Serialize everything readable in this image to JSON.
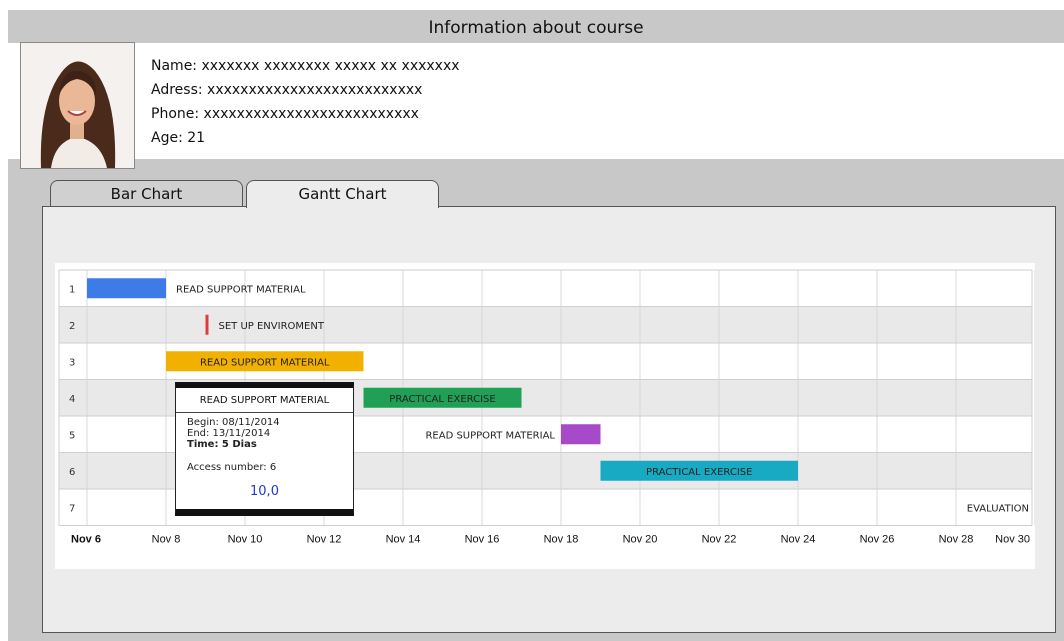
{
  "header": {
    "title": "Information about course"
  },
  "profile": {
    "name": "Name: xxxxxxx xxxxxxxx xxxxx xx xxxxxxx",
    "address": "Adress: xxxxxxxxxxxxxxxxxxxxxxxxxx",
    "phone": "Phone: xxxxxxxxxxxxxxxxxxxxxxxxxx",
    "age": "Age: 21"
  },
  "tabs": [
    {
      "label": "Bar Chart",
      "active": false
    },
    {
      "label": "Gantt Chart",
      "active": true
    }
  ],
  "chart_data": {
    "type": "gantt",
    "x_axis_start": "Nov 6",
    "x_ticks": [
      "Nov 6",
      "Nov 8",
      "Nov 10",
      "Nov 12",
      "Nov 14",
      "Nov 16",
      "Nov 18",
      "Nov 20",
      "Nov 22",
      "Nov 24",
      "Nov 26",
      "Nov 28",
      "Nov 30"
    ],
    "rows": [
      "1",
      "2",
      "3",
      "4",
      "5",
      "6",
      "7"
    ],
    "tasks": [
      {
        "row": 1,
        "label": "READ SUPPORT MATERIAL",
        "start": "Nov 6",
        "end": "Nov 8",
        "color": "#3c7be8",
        "label_position": "right"
      },
      {
        "row": 2,
        "label": "SET UP ENVIROMENT",
        "start": "Nov 9",
        "end": "Nov 9",
        "color": "#e03a3a",
        "label_position": "right"
      },
      {
        "row": 3,
        "label": "READ SUPPORT MATERIAL",
        "start": "Nov 8",
        "end": "Nov 13",
        "color": "#f2b100",
        "label_position": "inside"
      },
      {
        "row": 4,
        "label": "PRACTICAL EXERCISE",
        "start": "Nov 13",
        "end": "Nov 17",
        "color": "#1fa055",
        "label_position": "inside"
      },
      {
        "row": 5,
        "label": "READ SUPPORT MATERIAL",
        "start": "Nov 18",
        "end": "Nov 19",
        "color": "#a64ac9",
        "label_position": "left"
      },
      {
        "row": 6,
        "label": "PRACTICAL EXERCISE",
        "start": "Nov 19",
        "end": "Nov 24",
        "color": "#17aac2",
        "label_position": "inside"
      },
      {
        "row": 7,
        "label": "EVALUATION",
        "start": "Nov 30",
        "end": "Nov 30",
        "color": "#e8642c",
        "label_position": "left"
      }
    ]
  },
  "popup": {
    "title": "READ SUPPORT MATERIAL",
    "begin": "Begin: 08/11/2014",
    "end": "End: 13/11/2014",
    "time": "Time: 5 Dias",
    "access": "Access number: 6",
    "score": "10,0"
  },
  "colors": {
    "frame": "#c8c8c8",
    "panel": "#ececec",
    "score": "#1f3bd1"
  }
}
